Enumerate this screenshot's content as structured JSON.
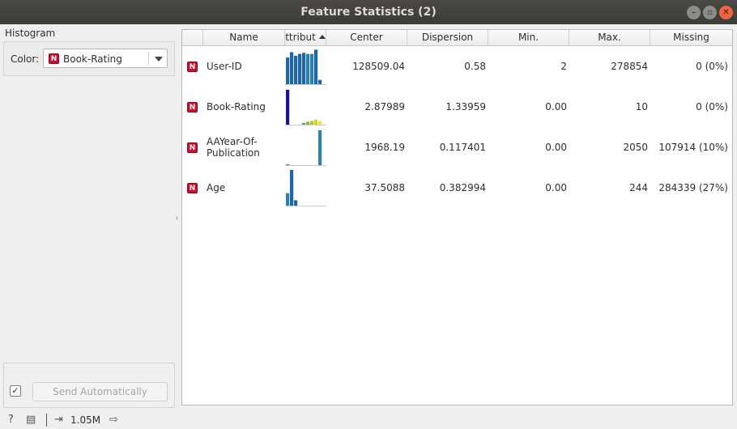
{
  "window": {
    "title": "Feature Statistics (2)"
  },
  "left_panel": {
    "histogram_title": "Histogram",
    "color_label": "Color:",
    "color_value": "Book-Rating",
    "color_type": "N",
    "send_automatically": "Send Automatically",
    "send_checked": "✓"
  },
  "table": {
    "headers": [
      "",
      "Name",
      "ttribut",
      "Center",
      "Dispersion",
      "Min.",
      "Max.",
      "Missing"
    ],
    "rows": [
      {
        "type": "N",
        "name": "User-ID",
        "center": "128509.04",
        "dispersion": "0.58",
        "min": "2",
        "max": "278854",
        "missing": "0 (0%)",
        "hist": [
          0.75,
          0.9,
          0.8,
          0.85,
          0.88,
          0.85,
          0.85,
          0.97,
          0.12
        ],
        "hist_colors": [
          "#1f66a6",
          "#1f66a6",
          "#1f66a6",
          "#1f66a6",
          "#1f66a6",
          "#2b82b0",
          "#2b82b0",
          "#1f66a6",
          "#1f66a6"
        ]
      },
      {
        "type": "N",
        "name": "Book-Rating",
        "center": "2.87989",
        "dispersion": "1.33959",
        "min": "0.00",
        "max": "10",
        "missing": "0 (0%)",
        "hist": [
          0.98,
          0,
          0,
          0,
          0.05,
          0.08,
          0.1,
          0.14,
          0.1
        ],
        "hist_colors": [
          "#1a10a8",
          "#2e2aa6",
          "#2e5aa6",
          "#2e8aa0",
          "#4caf50",
          "#7bbf3a",
          "#a7c92f",
          "#d3d32a",
          "#e6e24a"
        ]
      },
      {
        "type": "N",
        "name": "AAYear-Of-\nPublication",
        "center": "1968.19",
        "dispersion": "0.117401",
        "min": "0.00",
        "max": "2050",
        "missing": "107914 (10%)",
        "hist": [
          0.02,
          0,
          0,
          0,
          0,
          0,
          0,
          0,
          0.98
        ],
        "hist_colors": [
          "#1f66a6",
          "#1f66a6",
          "#1f66a6",
          "#1f66a6",
          "#1f66a6",
          "#1f66a6",
          "#1f66a6",
          "#1f66a6",
          "#2b82b0"
        ]
      },
      {
        "type": "N",
        "name": "Age",
        "center": "37.5088",
        "dispersion": "0.382994",
        "min": "0.00",
        "max": "244",
        "missing": "284339 (27%)",
        "hist": [
          0.35,
          1.0,
          0.15,
          0,
          0,
          0,
          0,
          0,
          0
        ],
        "hist_colors": [
          "#2b82b0",
          "#1f66a6",
          "#1f66a6",
          "#1f66a6",
          "#1f66a6",
          "#1f66a6",
          "#1f66a6",
          "#1f66a6",
          "#1f66a6"
        ]
      }
    ]
  },
  "status": {
    "data_size": "1.05M"
  }
}
